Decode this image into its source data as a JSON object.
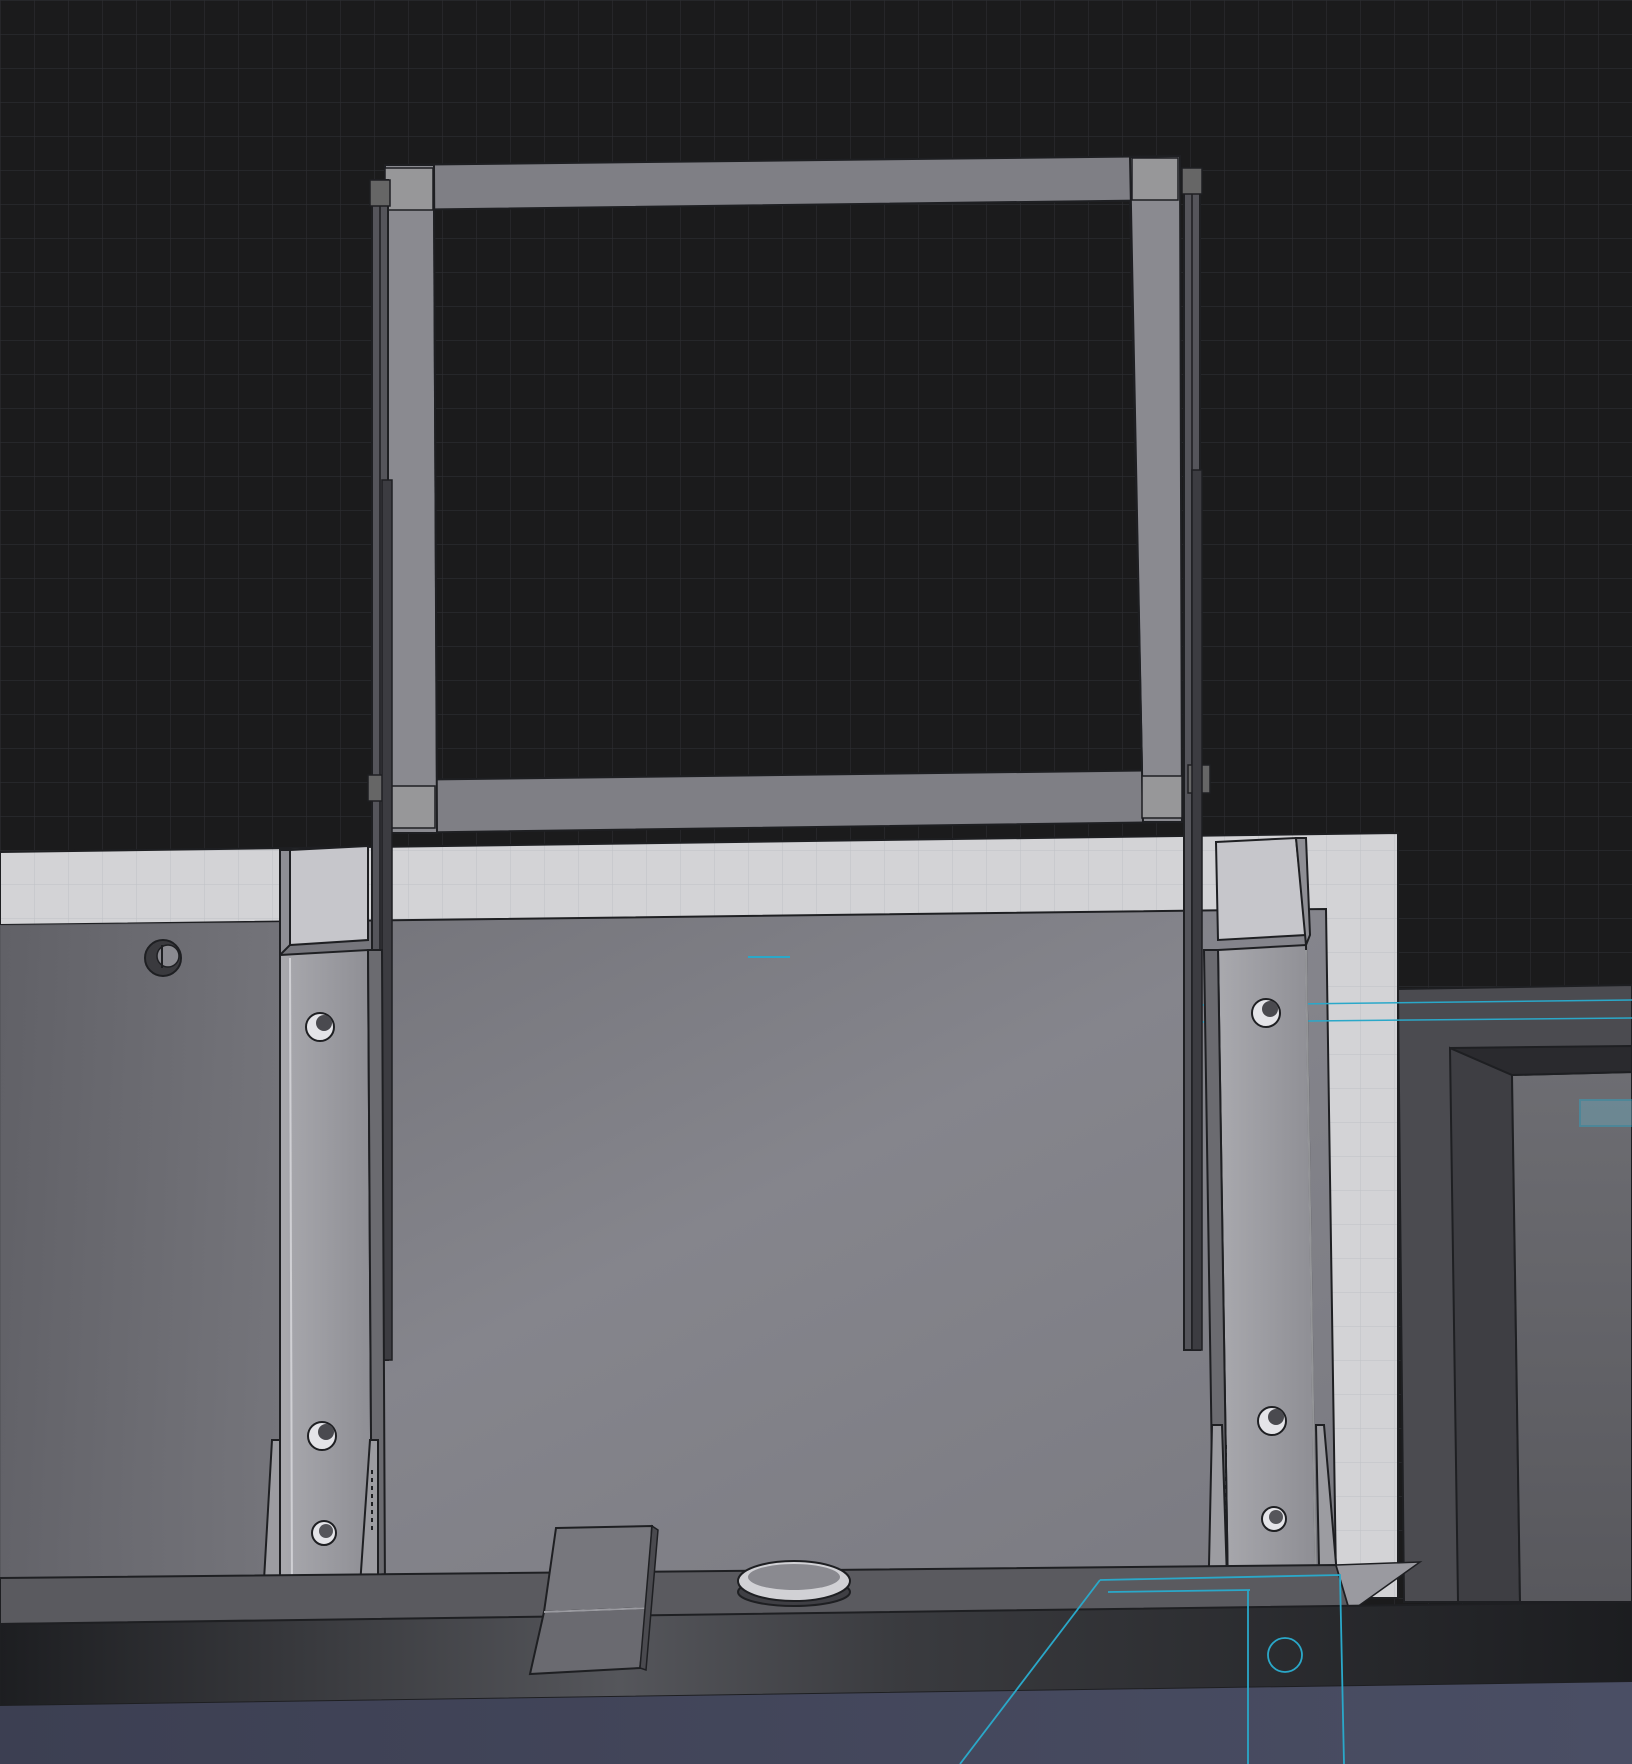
{
  "app": {
    "view": "3d-cad-viewport",
    "render_mode": "shaded-with-edges"
  },
  "scene": {
    "background_color": "#1b1b1c",
    "grid_color": "#2f3033",
    "edge_color": "#1e1f22",
    "selection_color": "#2aa8c9",
    "objects": [
      "top-rectangular-frame",
      "back-wall-panel",
      "left-bracket",
      "right-bracket",
      "base-rail",
      "hinge-tab",
      "round-boss",
      "side-enclosure"
    ]
  }
}
